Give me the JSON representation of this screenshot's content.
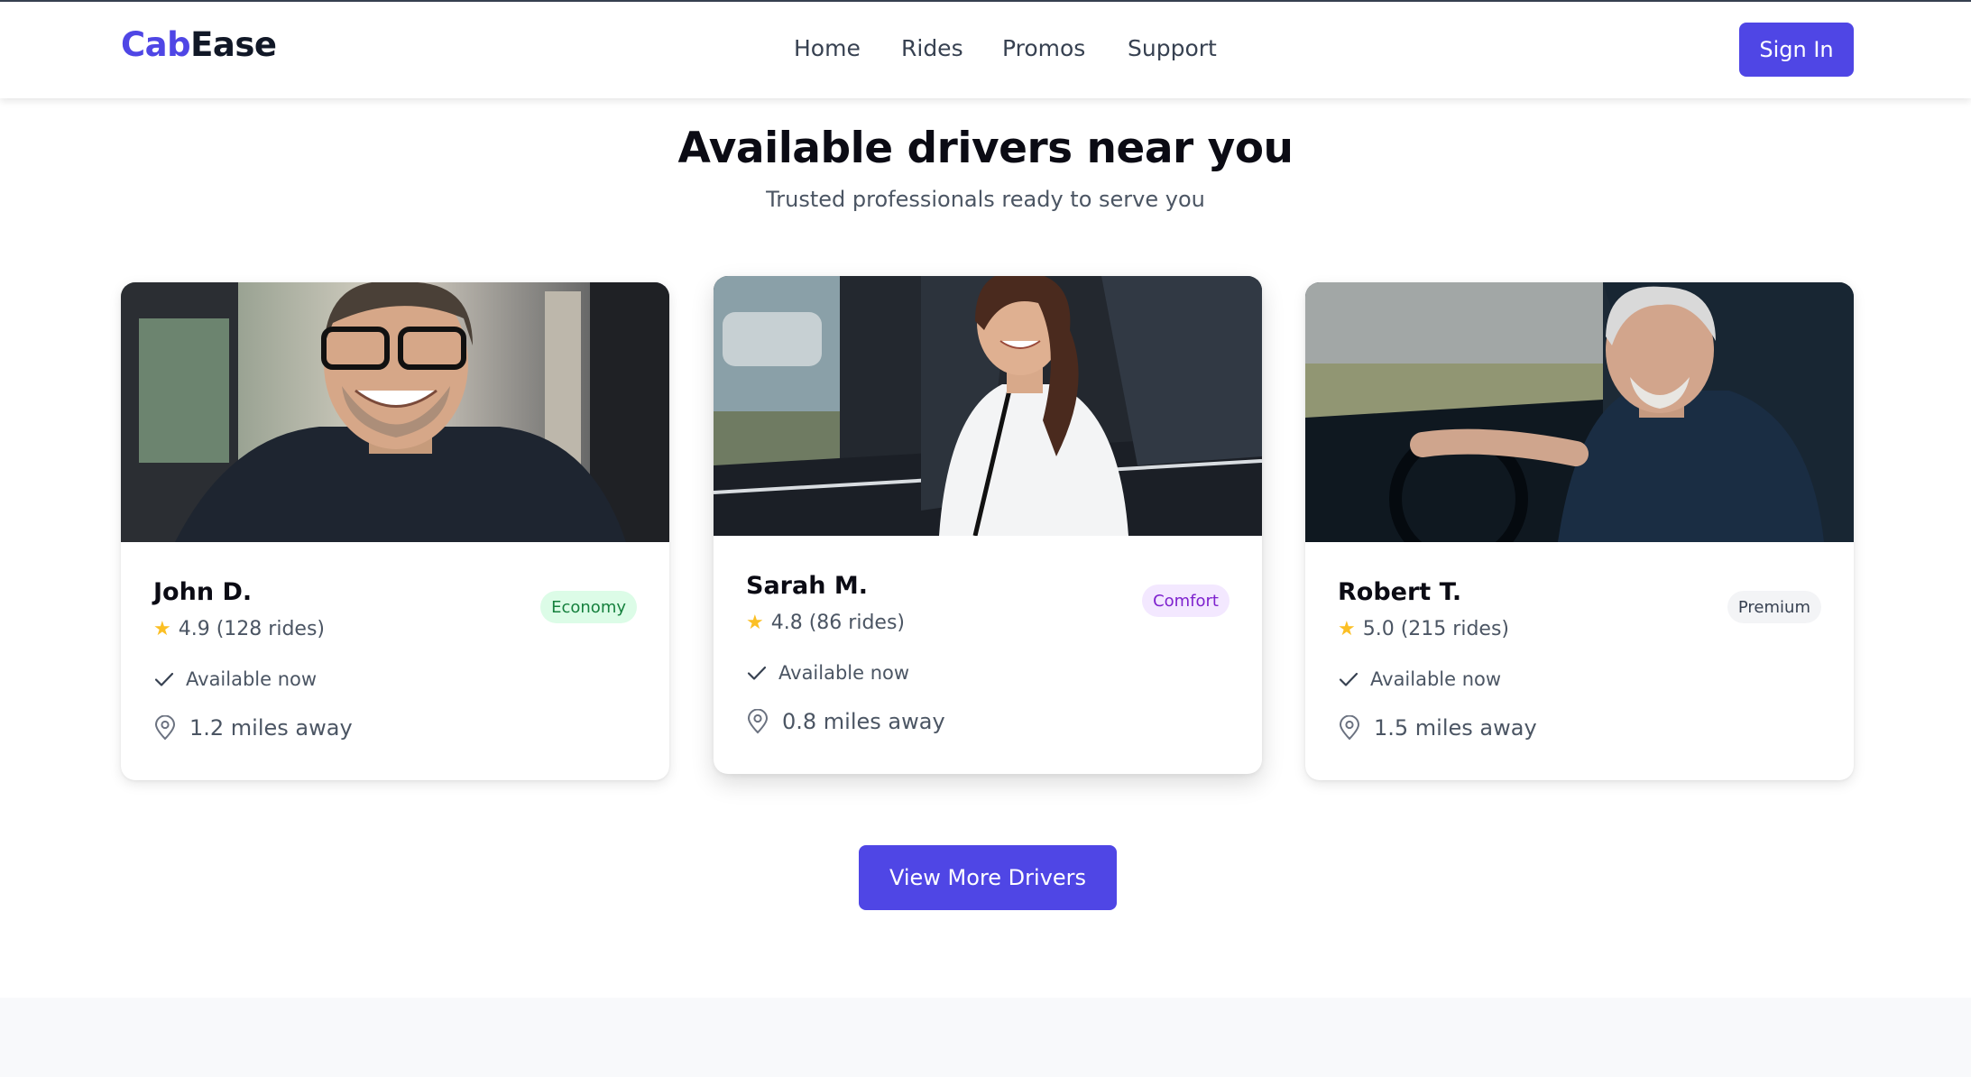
{
  "app": {
    "logo_part1": "Cab",
    "logo_part2": "Ease"
  },
  "nav": {
    "items": [
      {
        "label": "Home"
      },
      {
        "label": "Rides"
      },
      {
        "label": "Promos"
      },
      {
        "label": "Support"
      }
    ],
    "sign_in_label": "Sign In"
  },
  "section": {
    "title": "Available drivers near you",
    "subtitle": "Trusted professionals ready to serve you"
  },
  "drivers": [
    {
      "name": "John D.",
      "rating": "4.9 (128 rides)",
      "tier": "Economy",
      "availability": "Available now",
      "distance": "1.2 miles away"
    },
    {
      "name": "Sarah M.",
      "rating": "4.8 (86 rides)",
      "tier": "Comfort",
      "availability": "Available now",
      "distance": "0.8 miles away"
    },
    {
      "name": "Robert T.",
      "rating": "5.0 (215 rides)",
      "tier": "Premium",
      "availability": "Available now",
      "distance": "1.5 miles away"
    }
  ],
  "cta": {
    "view_more_label": "View More Drivers"
  },
  "colors": {
    "accent": "#4f46e5",
    "star": "#fbbf24",
    "economy_bg": "#dcfce7",
    "economy_text": "#15803d",
    "comfort_bg": "#f3e8ff",
    "comfort_text": "#7e22ce",
    "premium_bg": "#f3f4f6",
    "premium_text": "#374151"
  },
  "icons": {
    "star": "star-icon",
    "check": "check-icon",
    "location": "map-pin-icon"
  }
}
